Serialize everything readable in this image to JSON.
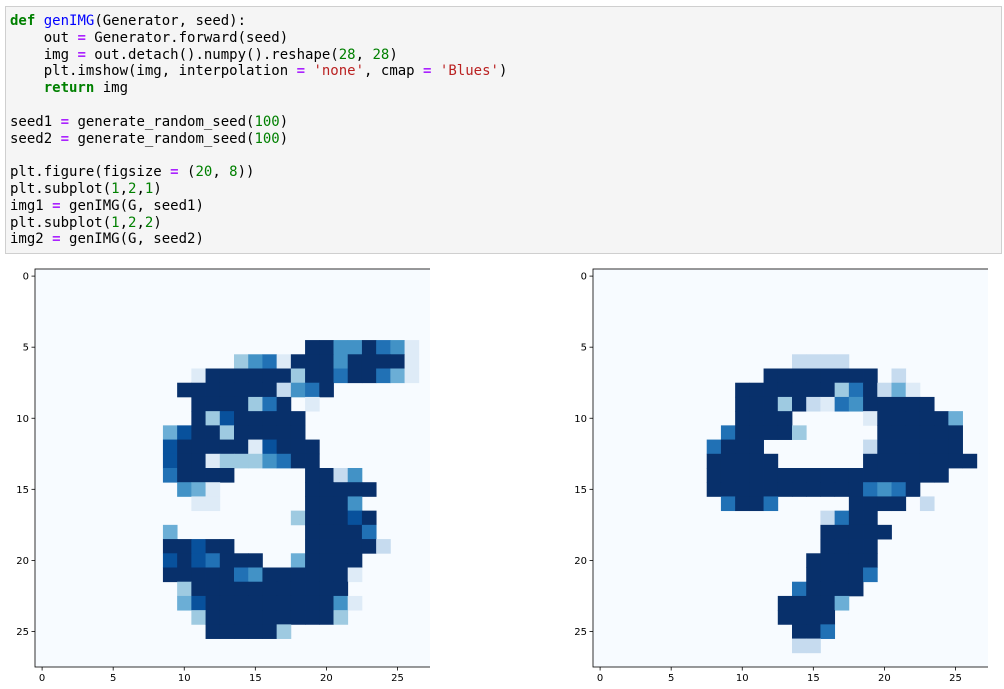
{
  "code_cell": {
    "lines": [
      [
        {
          "t": "kw",
          "v": "def"
        },
        {
          "t": "",
          "v": " "
        },
        {
          "t": "fn",
          "v": "genIMG"
        },
        {
          "t": "",
          "v": "(Generator, seed):"
        }
      ],
      [
        {
          "t": "",
          "v": "    out "
        },
        {
          "t": "op",
          "v": "="
        },
        {
          "t": "",
          "v": " Generator.forward(seed)"
        }
      ],
      [
        {
          "t": "",
          "v": "    img "
        },
        {
          "t": "op",
          "v": "="
        },
        {
          "t": "",
          "v": " out.detach().numpy().reshape("
        },
        {
          "t": "num",
          "v": "28"
        },
        {
          "t": "",
          "v": ", "
        },
        {
          "t": "num",
          "v": "28"
        },
        {
          "t": "",
          "v": ")"
        }
      ],
      [
        {
          "t": "",
          "v": "    plt.imshow(img, interpolation "
        },
        {
          "t": "op",
          "v": "="
        },
        {
          "t": "",
          "v": " "
        },
        {
          "t": "str",
          "v": "'none'"
        },
        {
          "t": "",
          "v": ", cmap "
        },
        {
          "t": "op",
          "v": "="
        },
        {
          "t": "",
          "v": " "
        },
        {
          "t": "str",
          "v": "'Blues'"
        },
        {
          "t": "",
          "v": ")"
        }
      ],
      [
        {
          "t": "",
          "v": "    "
        },
        {
          "t": "kw",
          "v": "return"
        },
        {
          "t": "",
          "v": " img"
        }
      ],
      [
        {
          "t": "",
          "v": ""
        }
      ],
      [
        {
          "t": "",
          "v": "seed1 "
        },
        {
          "t": "op",
          "v": "="
        },
        {
          "t": "",
          "v": " generate_random_seed("
        },
        {
          "t": "num",
          "v": "100"
        },
        {
          "t": "",
          "v": ")"
        }
      ],
      [
        {
          "t": "",
          "v": "seed2 "
        },
        {
          "t": "op",
          "v": "="
        },
        {
          "t": "",
          "v": " generate_random_seed("
        },
        {
          "t": "num",
          "v": "100"
        },
        {
          "t": "",
          "v": ")"
        }
      ],
      [
        {
          "t": "",
          "v": ""
        }
      ],
      [
        {
          "t": "",
          "v": "plt.figure(figsize "
        },
        {
          "t": "op",
          "v": "="
        },
        {
          "t": "",
          "v": " ("
        },
        {
          "t": "num",
          "v": "20"
        },
        {
          "t": "",
          "v": ", "
        },
        {
          "t": "num",
          "v": "8"
        },
        {
          "t": "",
          "v": "))"
        }
      ],
      [
        {
          "t": "",
          "v": "plt.subplot("
        },
        {
          "t": "num",
          "v": "1"
        },
        {
          "t": "",
          "v": ","
        },
        {
          "t": "num",
          "v": "2"
        },
        {
          "t": "",
          "v": ","
        },
        {
          "t": "num",
          "v": "1"
        },
        {
          "t": "",
          "v": ")"
        }
      ],
      [
        {
          "t": "",
          "v": "img1 "
        },
        {
          "t": "op",
          "v": "="
        },
        {
          "t": "",
          "v": " genIMG(G, seed1)"
        }
      ],
      [
        {
          "t": "",
          "v": "plt.subplot("
        },
        {
          "t": "num",
          "v": "1"
        },
        {
          "t": "",
          "v": ","
        },
        {
          "t": "num",
          "v": "2"
        },
        {
          "t": "",
          "v": ","
        },
        {
          "t": "num",
          "v": "2"
        },
        {
          "t": "",
          "v": ")"
        }
      ],
      [
        {
          "t": "",
          "v": "img2 "
        },
        {
          "t": "op",
          "v": "="
        },
        {
          "t": "",
          "v": " genIMG(G, seed2)"
        }
      ]
    ]
  },
  "output": {
    "colormap": [
      "#f7fbff",
      "#deebf7",
      "#c6dbef",
      "#9ecae1",
      "#6baed6",
      "#4292c6",
      "#2171b5",
      "#08519c",
      "#08306b"
    ],
    "chart_data": [
      {
        "type": "heatmap",
        "xlim": [
          -0.5,
          27.5
        ],
        "ylim": [
          27.5,
          -0.5
        ],
        "xticks": [
          0,
          5,
          10,
          15,
          20,
          25
        ],
        "yticks": [
          0,
          5,
          10,
          15,
          20,
          25
        ],
        "xtick_labels": [
          "0",
          "5",
          "10",
          "15",
          "20",
          "25"
        ],
        "ytick_labels": [
          "0",
          "5",
          "10",
          "15",
          "20",
          "25"
        ],
        "grid": false,
        "values": [
          "............................",
          "............................",
          "............................",
          "............................",
          "............................",
          "...................99558651.",
          "..............3561999599991.",
          "...........1999999399699641.",
          "..........99999992569......",
          "...........9999369.1........",
          "...........93799999.........",
          ".........4798399999.........",
          ".........79999917999........",
          ".........79913335699........",
          ".........69999.....9925.....",
          "..........541......99999....",
          "...........11......9995.....",
          "..................399979....",
          ".........4.........99996....",
          ".........89799.....999992...",
          ".........7976999..49999.....",
          ".........99999659999991.....",
          "..........399999999998......",
          "..........4799999999951.....",
          "...........39999999993......",
          "............999993..........",
          "............................",
          "............................"
        ]
      },
      {
        "type": "heatmap",
        "xlim": [
          -0.5,
          27.5
        ],
        "ylim": [
          27.5,
          -0.5
        ],
        "xticks": [
          0,
          5,
          10,
          15,
          20,
          25
        ],
        "yticks": [
          0,
          5,
          10,
          15,
          20,
          25
        ],
        "xtick_labels": [
          "0",
          "5",
          "10",
          "15",
          "20",
          "25"
        ],
        "ytick_labels": [
          "0",
          "5",
          "10",
          "15",
          "20",
          "25"
        ],
        "grid": false,
        "values": [
          "............................",
          "............................",
          "............................",
          "............................",
          "............................",
          "............................",
          "..............2222..........",
          "............99999999.2......",
          "..........9999999369241.....",
          "..........99939216599999....",
          "..........9999.....1999994..",
          ".........699993.....999999..",
          "........6999.......2999999..",
          "........99999......99999999.",
          "........99999999999999999...",
          "........999999999996569.....",
          ".........6996.....9999.2....",
          "................2699........",
          "................99999.......",
          "................9999........",
          "...............99999........",
          "...............99996........",
          "..............69999.........",
          ".............99994..........",
          ".............9999...........",
          "..............996...........",
          "..............22............",
          "............................"
        ]
      }
    ]
  }
}
